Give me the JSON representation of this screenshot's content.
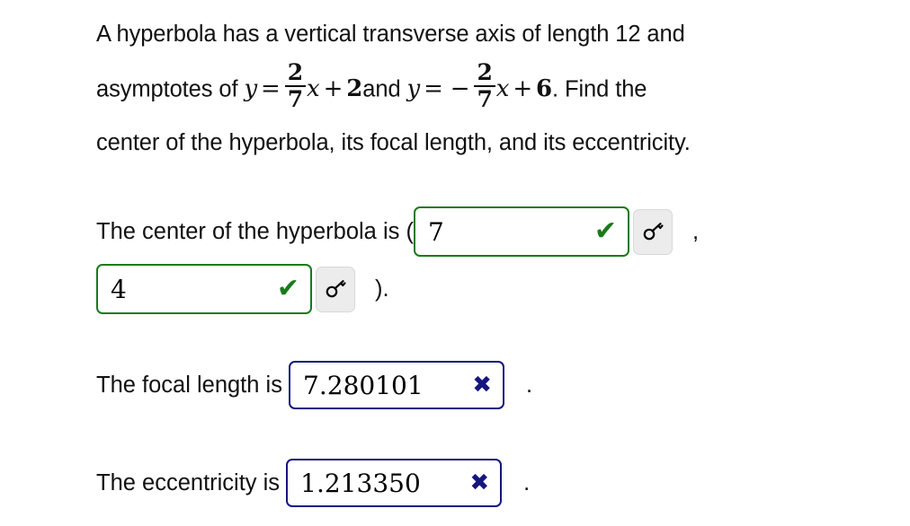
{
  "problem": {
    "line1": "A hyperbola has a vertical transverse axis of length 12 and",
    "line2_prefix": "asymptotes of ",
    "asymptote1": {
      "y": "y",
      "equals": "=",
      "frac_num": "2",
      "frac_den": "7",
      "var": "x",
      "plus": "+",
      "constant": "2",
      "text": "y = 2/7 x + 2"
    },
    "line2_join": "and ",
    "asymptote2": {
      "y": "y",
      "equals": "=",
      "minus": "−",
      "frac_num": "2",
      "frac_den": "7",
      "var": "x",
      "plus": "+",
      "constant": "6",
      "text": "y = -2/7 x + 6"
    },
    "line2_suffix": ". Find the",
    "line3": "center of the hyperbola, its focal length, and its eccentricity."
  },
  "answers": {
    "center": {
      "prompt": "The center of the hyperbola is (",
      "x": {
        "value": "7",
        "status": "correct",
        "mark_icon": "check-icon",
        "mark_glyph": "✔",
        "border_color": "#1a7a1a",
        "key_icon": "key-icon"
      },
      "separator": ",",
      "y": {
        "value": "4",
        "status": "correct",
        "mark_icon": "check-icon",
        "mark_glyph": "✔",
        "border_color": "#1a7a1a",
        "key_icon": "key-icon"
      },
      "closing": ")."
    },
    "focal_length": {
      "prompt": "The focal length is ",
      "value": "7.280101",
      "status": "incorrect",
      "mark_icon": "cross-icon",
      "mark_glyph": "✖",
      "border_color": "#151580",
      "trailing": "."
    },
    "eccentricity": {
      "prompt": "The eccentricity is ",
      "value": "1.213350",
      "status": "incorrect",
      "mark_icon": "cross-icon",
      "mark_glyph": "✖",
      "border_color": "#151580",
      "trailing": "."
    }
  }
}
